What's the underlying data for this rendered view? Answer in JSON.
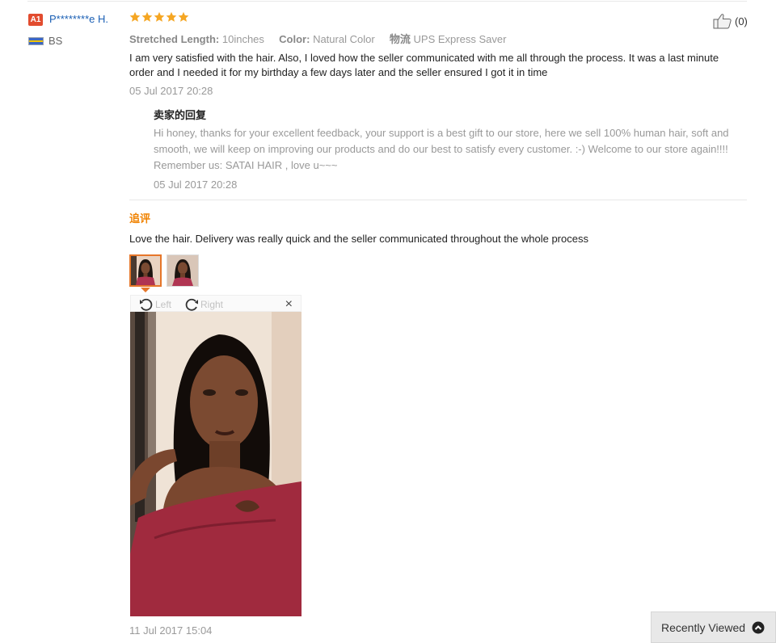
{
  "buyer": {
    "level_badge": "A1",
    "name": "P********e H.",
    "country": "BS"
  },
  "review": {
    "rating_stars": 5,
    "helpful_count": "(0)",
    "attributes": [
      {
        "key": "Stretched Length:",
        "value": "10inches"
      },
      {
        "key": "Color:",
        "value": "Natural Color"
      },
      {
        "key": "物流",
        "value": "UPS Express Saver"
      }
    ],
    "text": "I am very satisfied with the hair. Also, I loved how the seller communicated with me all through the process. It was a last minute order and I needed it for my birthday a few days later and the seller ensured I got it in time",
    "date": "05 Jul 2017 20:28"
  },
  "seller_reply": {
    "title": "卖家的回复",
    "text": "Hi honey, thanks for your excellent feedback, your support is a best gift to our store, here we sell 100% human hair, soft and smooth, we will keep on improving our products and do our best to satisfy every customer. :-) Welcome to our store again!!!! Remember us: SATAI HAIR , love u~~~",
    "date": "05 Jul 2017 20:28"
  },
  "additional_feedback": {
    "label": "追评",
    "text": "Love the hair. Delivery was really quick and the seller communicated throughout the whole process",
    "date": "11 Jul 2017 15:04"
  },
  "viewer": {
    "rotate_left_label": "Left",
    "rotate_right_label": "Right",
    "close_label": "×"
  },
  "recently_viewed": {
    "label": "Recently Viewed"
  },
  "colors": {
    "star": "#f5a623",
    "badge": "#e24c2f",
    "name_link": "#1a5fb4",
    "append_label": "#f08200",
    "active_thumb_border": "#e6762a"
  }
}
